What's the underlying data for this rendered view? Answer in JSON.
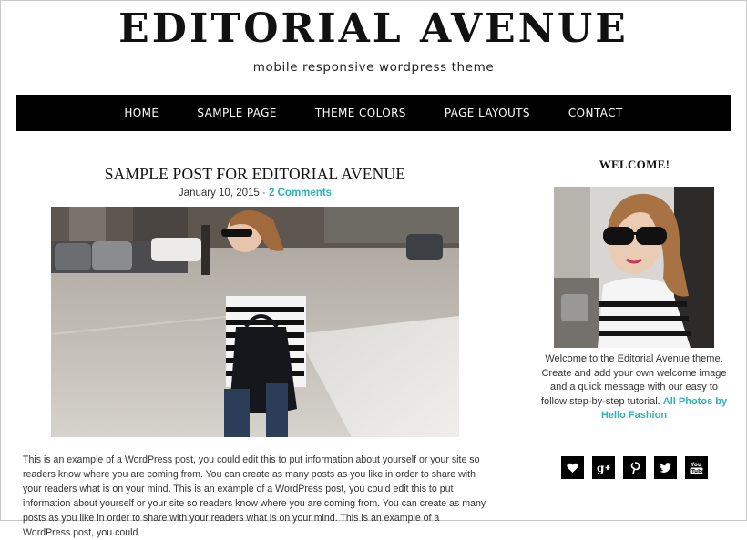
{
  "header": {
    "site_title": "EDITORIAL AVENUE",
    "tagline": "mobile responsive wordpress theme"
  },
  "nav": {
    "items": [
      "HOME",
      "SAMPLE PAGE",
      "THEME COLORS",
      "PAGE LAYOUTS",
      "CONTACT"
    ]
  },
  "post": {
    "title": "SAMPLE POST FOR EDITORIAL AVENUE",
    "date": "January 10, 2015",
    "separator": " · ",
    "comments": "2 Comments",
    "body": "This is an example of a WordPress post, you could edit this to put information about yourself or your site so readers know where you are coming from. You can create as many posts as you like in order to share with your readers what is on your mind. This is an example of a WordPress post, you could edit this to put information about yourself or your site so readers know where you are coming from. You can create as many posts as you like in order to share with your readers what is on your mind. This is an example of a WordPress post, you could"
  },
  "sidebar": {
    "widget_title": "WELCOME!",
    "welcome_text": "Welcome to the Editorial Avenue theme. Create and add your own welcome image and a quick message with our easy to follow step-by-step tutorial. ",
    "photo_credit": "All Photos by Hello Fashion"
  },
  "social": {
    "icons": [
      "heart-icon",
      "google-plus-icon",
      "pinterest-icon",
      "twitter-icon",
      "youtube-icon"
    ]
  },
  "colors": {
    "accent": "#2ab4b4",
    "nav_bg": "#000000",
    "text": "#333333"
  }
}
